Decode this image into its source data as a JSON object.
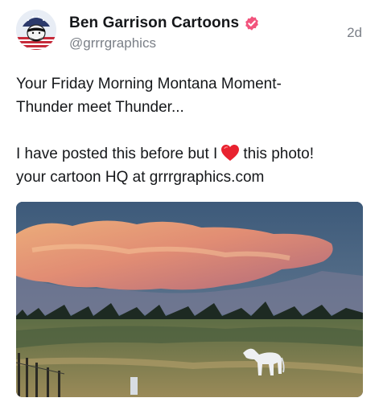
{
  "author": {
    "display_name": "Ben Garrison Cartoons",
    "handle": "@grrrgraphics",
    "avatar_icon": "cartoon-avatar-icon",
    "verified_icon": "verified-badge-icon",
    "verified_color": "#f2547d"
  },
  "post": {
    "timestamp": "2d",
    "lines": [
      "Your Friday Morning Montana Moment-",
      "Thunder meet Thunder..."
    ],
    "line_before_heart": "I have posted this before but I",
    "heart_icon": "red-heart-emoji-icon",
    "line_after_heart": "this photo!",
    "last_line": "your cartoon HQ at grrrgraphics.com",
    "image_icon": "montana-storm-cloud-white-horse-photo"
  }
}
